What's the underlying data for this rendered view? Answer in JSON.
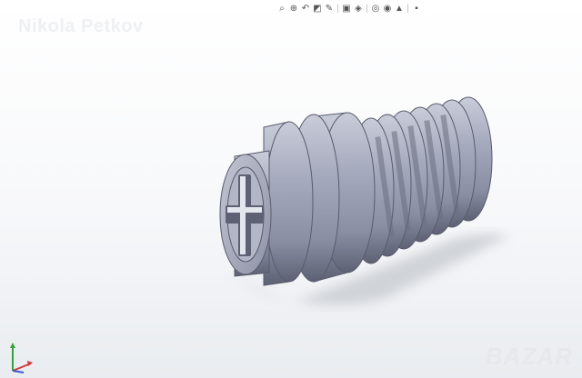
{
  "watermark": {
    "text": "Nikola Petkov"
  },
  "brand": {
    "text": "BAZAR"
  },
  "toolbar": {
    "items": [
      {
        "name": "zoom-to-fit-icon",
        "glyph": "⌕"
      },
      {
        "name": "zoom-area-icon",
        "glyph": "⌕"
      },
      {
        "name": "previous-view-icon",
        "glyph": "↶"
      },
      {
        "name": "section-view-icon",
        "glyph": "◩"
      },
      {
        "name": "dynamic-annotation-icon",
        "glyph": "✎"
      },
      {
        "name": "view-orientation-icon",
        "glyph": "▣"
      },
      {
        "name": "display-style-icon",
        "glyph": "◈"
      },
      {
        "name": "hide-show-items-icon",
        "glyph": "◎"
      },
      {
        "name": "edit-appearance-icon",
        "glyph": "◉"
      },
      {
        "name": "apply-scene-icon",
        "glyph": "▲"
      },
      {
        "name": "view-settings-icon",
        "glyph": "▪"
      }
    ]
  },
  "colors": {
    "part_body": "#9aa0b4",
    "part_light": "#c9ccd9",
    "part_dark": "#5d6173",
    "shadow": "#c8ccd2",
    "triad_x": "#d23a3a",
    "triad_y": "#3aa13a",
    "triad_z": "#3a5ad2"
  }
}
